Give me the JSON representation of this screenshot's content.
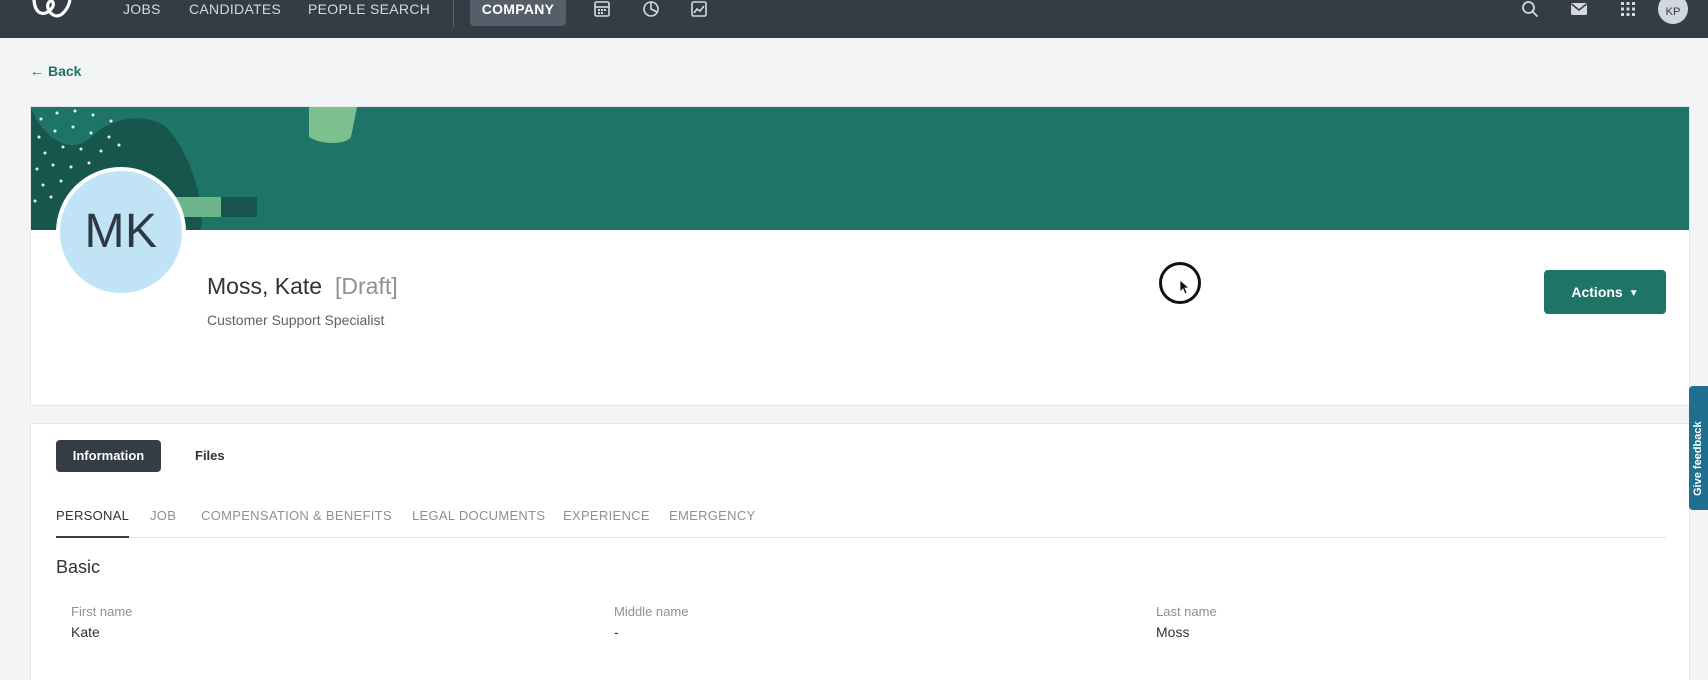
{
  "nav": {
    "links": [
      "JOBS",
      "CANDIDATES",
      "PEOPLE SEARCH"
    ],
    "active": "COMPANY",
    "icons": [
      "calendar-icon",
      "pie-chart-icon",
      "image-chart-icon"
    ],
    "right_icons": [
      "search-icon",
      "mail-icon",
      "apps-grid-icon"
    ],
    "user_initials": "KP"
  },
  "back": {
    "label": "Back"
  },
  "profile": {
    "initials": "MK",
    "name": "Moss, Kate",
    "status": "[Draft]",
    "title": "Customer Support Specialist",
    "actions_label": "Actions"
  },
  "details": {
    "tabs": [
      "Information",
      "Files"
    ],
    "subtabs": [
      "PERSONAL",
      "JOB",
      "COMPENSATION & BENEFITS",
      "LEGAL DOCUMENTS",
      "EXPERIENCE",
      "EMERGENCY"
    ],
    "section": "Basic",
    "fields": [
      {
        "label": "First name",
        "value": "Kate"
      },
      {
        "label": "Middle name",
        "value": "-"
      },
      {
        "label": "Last name",
        "value": "Moss"
      }
    ]
  },
  "feedback": {
    "label": "Give feedback"
  },
  "colors": {
    "brand": "#1f7468",
    "nav": "#343c46",
    "feedback": "#1f6f90"
  }
}
